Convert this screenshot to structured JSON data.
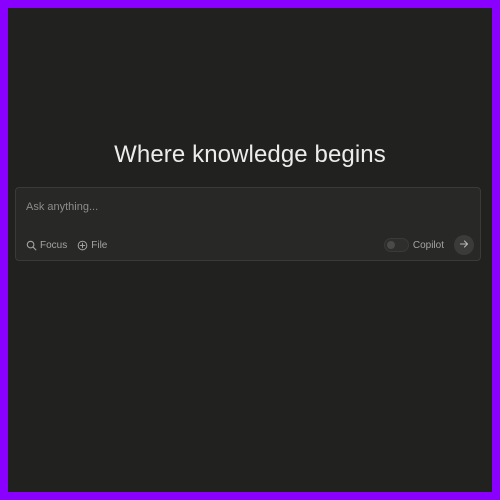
{
  "headline": "Where knowledge begins",
  "search": {
    "placeholder": "Ask anything..."
  },
  "toolbar": {
    "focus_label": "Focus",
    "file_label": "File",
    "copilot_label": "Copilot",
    "copilot_enabled": false
  },
  "icons": {
    "focus": "search-icon",
    "file": "plus-circle-icon",
    "submit": "arrow-right-icon"
  },
  "colors": {
    "frame_border": "#8a00ff",
    "background": "#212120",
    "search_box": "#282827",
    "headline_text": "#ecece8",
    "muted_text": "#a3a39f",
    "submit_button": "#3b3b3a"
  }
}
